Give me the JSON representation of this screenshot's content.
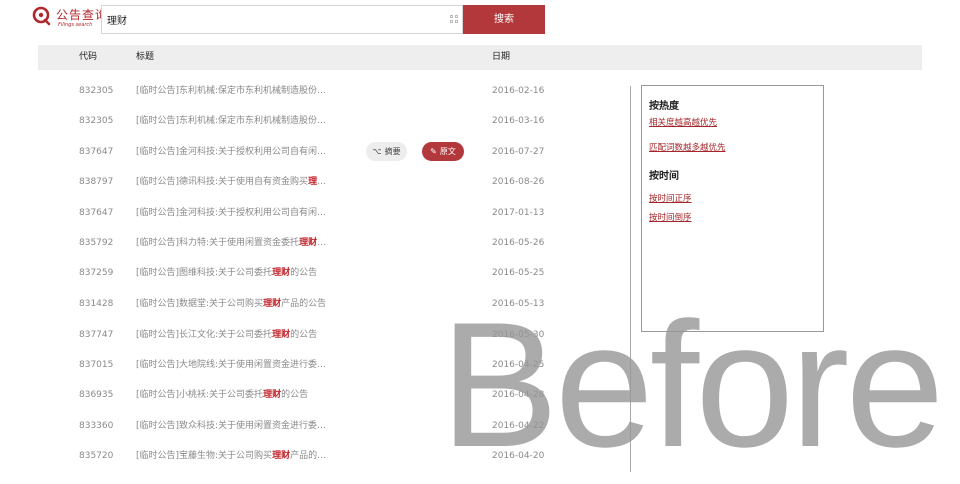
{
  "brand": {
    "logo_text": "公告查询",
    "logo_subtext": "Filings search",
    "accent_color": "#b2383b"
  },
  "search": {
    "value": "理财",
    "button_label": "搜索"
  },
  "table": {
    "headers": {
      "code": "代码",
      "title": "标题",
      "date": "日期"
    },
    "rows": [
      {
        "code": "832305",
        "title": "[临时公告]东利机械:保定市东利机械制造股份…",
        "title_tail": "",
        "date": "2016-02-16"
      },
      {
        "code": "832305",
        "title": "[临时公告]东利机械:保定市东利机械制造股份…",
        "title_tail": "",
        "date": "2016-03-16"
      },
      {
        "code": "837647",
        "title": "[临时公告]金河科技:关于授权利用公司自有闲…",
        "title_tail": "",
        "date": "2016-07-27"
      },
      {
        "code": "838797",
        "title": "[临时公告]德讯科技:关于使用自有资金购买",
        "highlight": "理",
        "title_tail": "…",
        "date": "2016-08-26"
      },
      {
        "code": "837647",
        "title": "[临时公告]金河科技:关于授权利用公司自有闲…",
        "title_tail": "",
        "date": "2017-01-13"
      },
      {
        "code": "835792",
        "title": "[临时公告]科力特:关于使用闲置资金委托",
        "highlight": "理财",
        "title_tail": "…",
        "date": "2016-05-26"
      },
      {
        "code": "837259",
        "title": "[临时公告]图维科技:关于公司委托",
        "highlight": "理财",
        "title_tail": "的公告",
        "date": "2016-05-25"
      },
      {
        "code": "831428",
        "title": "[临时公告]数据堂:关于公司购买",
        "highlight": "理财",
        "title_tail": "产品的公告",
        "date": "2016-05-13"
      },
      {
        "code": "837747",
        "title": "[临时公告]长江文化:关于公司委托",
        "highlight": "理财",
        "title_tail": "的公告",
        "date": "2016-05-30"
      },
      {
        "code": "837015",
        "title": "[临时公告]大地院线:关于使用闲置资金进行委…",
        "title_tail": "",
        "date": "2016-04-25"
      },
      {
        "code": "836935",
        "title": "[临时公告]小桃袄:关于公司委托",
        "highlight": "理财",
        "title_tail": "的公告",
        "date": "2016-04-28"
      },
      {
        "code": "833360",
        "title": "[临时公告]致众科技:关于使用闲置资金进行委…",
        "title_tail": "",
        "date": "2016-04-22"
      },
      {
        "code": "835720",
        "title": "[临时公告]宝藤生物:关于公司购买",
        "highlight": "理财",
        "title_tail": "产品的…",
        "date": "2016-04-20"
      }
    ],
    "row_actions": {
      "summary_label": "摘要",
      "original_label": "原文"
    }
  },
  "sort_panel": {
    "by_relevance_heading": "按热度",
    "relevance_options": [
      "相关度越高越优先",
      "匹配词数越多越优先"
    ],
    "by_time_heading": "按时间",
    "time_options": [
      "按时间正序",
      "按时间倒序"
    ]
  },
  "watermark": "Before"
}
